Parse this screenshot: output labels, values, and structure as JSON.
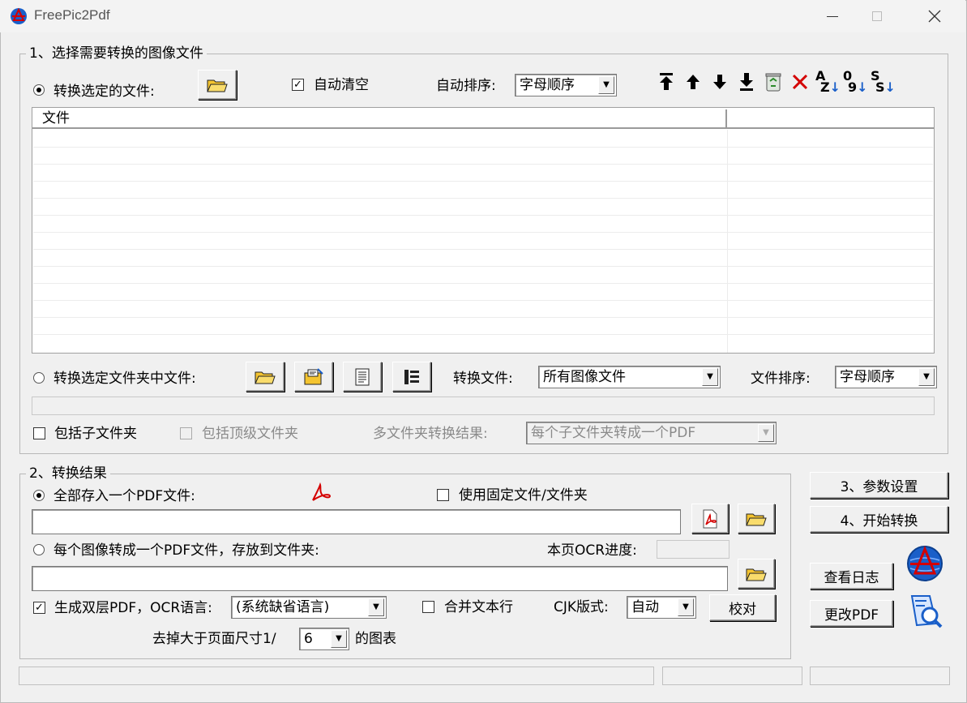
{
  "window": {
    "title": "FreePic2Pdf",
    "minimize_icon": "minimize-icon",
    "maximize_icon": "maximize-icon",
    "close_icon": "close-icon"
  },
  "section1": {
    "legend": "1、选择需要转换的图像文件",
    "convert_selected_files_label": "转换选定的文件:",
    "auto_clear_label": "自动清空",
    "auto_clear_checked": true,
    "auto_sort_label": "自动排序:",
    "auto_sort_value": "字母顺序",
    "toolbar": [
      {
        "name": "move-top-icon",
        "glyph": "⤒"
      },
      {
        "name": "move-up-icon",
        "glyph": "🡑"
      },
      {
        "name": "move-down-icon",
        "glyph": "🡓"
      },
      {
        "name": "move-bottom-icon",
        "glyph": "⤓"
      },
      {
        "name": "recycle-bin-icon",
        "glyph": "♻"
      },
      {
        "name": "delete-icon",
        "glyph": "✕"
      },
      {
        "name": "sort-az-icon",
        "glyph": "AZ"
      },
      {
        "name": "sort-09-icon",
        "glyph": "09"
      },
      {
        "name": "sort-size-icon",
        "glyph": "SS"
      }
    ],
    "file_list": {
      "column_file": "文件",
      "column_2": ""
    },
    "convert_folder_label": "转换选定文件夹中文件:",
    "convert_files_label": "转换文件:",
    "convert_files_value": "所有图像文件",
    "file_sort_label": "文件排序:",
    "file_sort_value": "字母顺序",
    "include_subfolders_label": "包括子文件夹",
    "include_top_folder_label": "包括顶级文件夹",
    "multi_folder_result_label": "多文件夹转换结果:",
    "multi_folder_result_value": "每个子文件夹转成一个PDF"
  },
  "section2": {
    "legend": "2、转换结果",
    "save_single_pdf_label": "全部存入一个PDF文件:",
    "use_fixed_label": "使用固定文件/文件夹",
    "each_image_label": "每个图像转成一个PDF文件，存放到文件夹:",
    "ocr_progress_label": "本页OCR进度:",
    "dual_layer_label": "生成双层PDF，OCR语言:",
    "dual_layer_checked": true,
    "ocr_language_value": "(系统缺省语言)",
    "merge_lines_label": "合并文本行",
    "cjk_layout_label": "CJK版式:",
    "cjk_layout_value": "自动",
    "proofread_button": "校对",
    "remove_charts_prefix": "去掉大于页面尺寸1/",
    "remove_charts_value": "6",
    "remove_charts_suffix": "的图表"
  },
  "side": {
    "params_button": "3、参数设置",
    "start_button": "4、开始转换",
    "view_log_button": "查看日志",
    "modify_pdf_button": "更改PDF"
  },
  "colors": {
    "accent_red": "#d40000",
    "folder_yellow": "#f4c430",
    "blue_icon": "#1a5fc9"
  }
}
